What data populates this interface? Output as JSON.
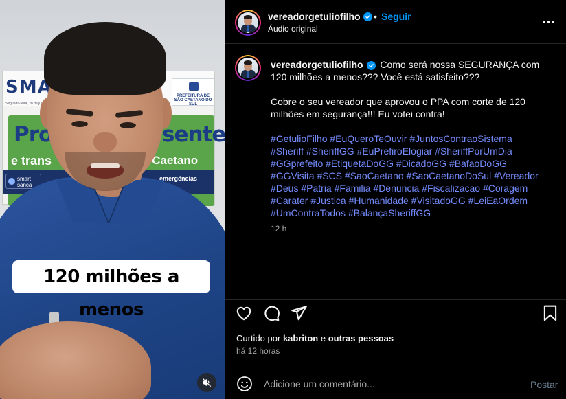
{
  "video": {
    "caption": "120 milhões a menos",
    "background_sign": {
      "top_left": "SMA",
      "small_caption": "Segunda-feira, 28 de julho de 2025",
      "prefeitura": "PREFEITURA DE SÃO CAETANO DO SUL",
      "line1_left": "Pro",
      "line1_right": "sente",
      "line2_left": "e trans",
      "line2_right": "o Caetano",
      "smart_logo": "smart sanca",
      "emergencias": "emergências"
    },
    "mute_icon": "speaker-muted-icon"
  },
  "header": {
    "username": "vereadorgetuliofilho",
    "verified": true,
    "separator": "•",
    "follow_label": "Seguir",
    "audio_label": "Áudio original",
    "more_icon": "more-horizontal-icon"
  },
  "post": {
    "username": "vereadorgetuliofilho",
    "caption_text": "Como será nossa SEGURANÇA com 120 milhões a menos??? Você está satisfeito???",
    "paragraph2": "Cobre o seu vereador que aprovou o PPA com corte de 120 milhões em segurança!!! Eu votei contra!",
    "hashtags": [
      "#GetulioFilho",
      "#EuQueroTeOuvir",
      "#JuntosContraoSistema",
      "#Sheriff",
      "#SheriffGG",
      "#EuPrefiroElogiar",
      "#SheriffPorUmDia",
      "#GGprefeito",
      "#EtiquetaDoGG",
      "#DicadoGG",
      "#BafaoDoGG",
      "#GGVisita",
      "#SCS",
      "#SaoCaetano",
      "#SaoCaetanoDoSul",
      "#Vereador",
      "#Deus",
      "#Patria",
      "#Familia",
      "#Denuncia",
      "#Fiscalizacao",
      "#Coragem",
      "#Carater",
      "#Justica",
      "#Humanidade",
      "#VisitadoGG",
      "#LeiEaOrdem",
      "#UmContraTodos",
      "#BalançaSheriffGG"
    ],
    "time": "12 h"
  },
  "actions": {
    "icons": [
      "heart-icon",
      "comment-icon",
      "share-icon",
      "bookmark-icon"
    ],
    "liked_prefix": "Curtido por",
    "liked_user": "kabriton",
    "liked_and": "e",
    "liked_others": "outras pessoas",
    "ago": "há 12 horas"
  },
  "compose": {
    "placeholder": "Adicione um comentário...",
    "post_label": "Postar",
    "emoji_icon": "emoji-icon"
  },
  "colors": {
    "link_blue": "#0095f6",
    "hashtag": "#738bfd",
    "text_secondary": "#a8a8a8",
    "background": "#000000"
  }
}
